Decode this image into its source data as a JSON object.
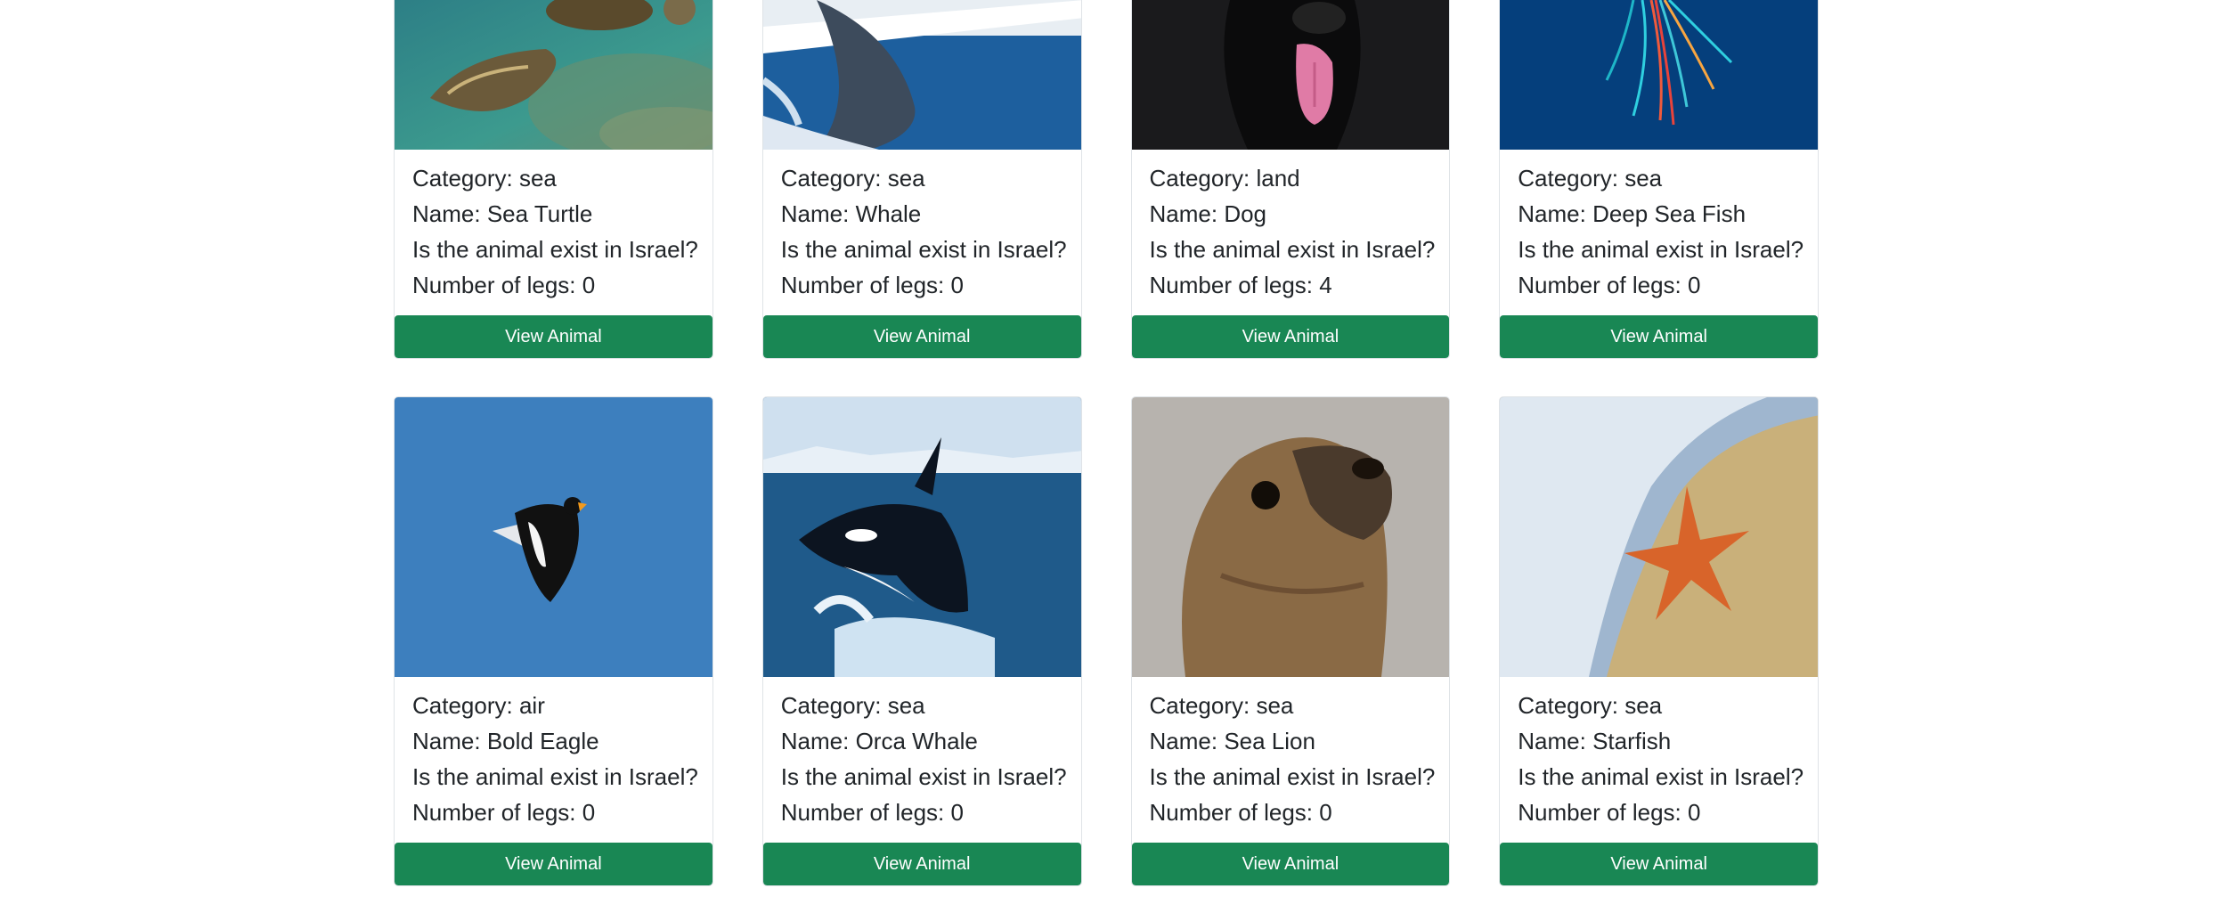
{
  "labels": {
    "category_prefix": "Category: ",
    "name_prefix": "Name: ",
    "israel_question": "Is the animal exist in Israel?",
    "legs_prefix": "Number of legs: ",
    "button": "View Animal"
  },
  "cards": [
    {
      "category": "sea",
      "name": "Sea Turtle",
      "legs": "0",
      "image_icon": "sea-turtle-photo"
    },
    {
      "category": "sea",
      "name": "Whale",
      "legs": "0",
      "image_icon": "whale-photo"
    },
    {
      "category": "land",
      "name": "Dog",
      "legs": "4",
      "image_icon": "dog-photo"
    },
    {
      "category": "sea",
      "name": "Deep Sea Fish",
      "legs": "0",
      "image_icon": "deep-sea-fish-photo"
    },
    {
      "category": "air",
      "name": "Bold Eagle",
      "legs": "0",
      "image_icon": "eagle-photo"
    },
    {
      "category": "sea",
      "name": "Orca Whale",
      "legs": "0",
      "image_icon": "orca-photo"
    },
    {
      "category": "sea",
      "name": "Sea Lion",
      "legs": "0",
      "image_icon": "sea-lion-photo"
    },
    {
      "category": "sea",
      "name": "Starfish",
      "legs": "0",
      "image_icon": "starfish-photo"
    }
  ],
  "colors": {
    "button_bg": "#198754",
    "button_text": "#ffffff",
    "card_border": "#dfe3e7"
  }
}
